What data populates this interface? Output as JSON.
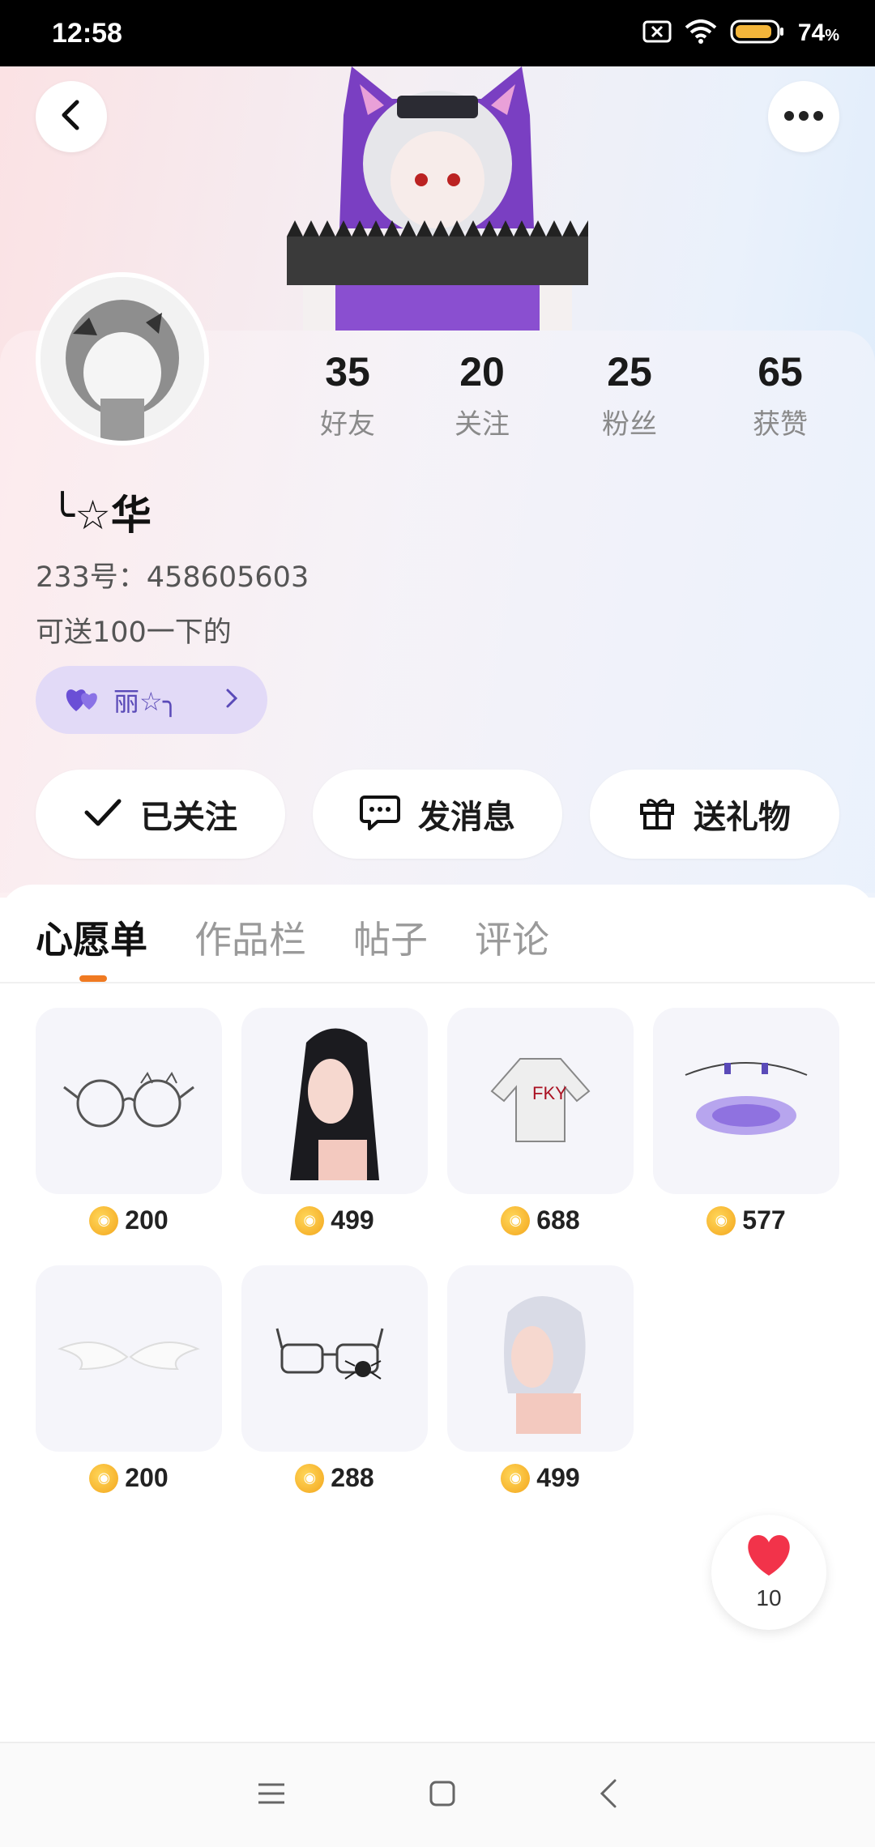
{
  "status_bar": {
    "time": "12:58",
    "battery": "74",
    "battery_unit": "%"
  },
  "profile": {
    "stats": [
      {
        "value": "35",
        "label": "好友"
      },
      {
        "value": "20",
        "label": "关注"
      },
      {
        "value": "25",
        "label": "粉丝"
      },
      {
        "value": "65",
        "label": "获赞"
      }
    ],
    "username": "╰☆华",
    "user_id": "233号：458605603",
    "bio": "可送100一下的",
    "cp_tag": "丽☆╮"
  },
  "actions": {
    "follow": "已关注",
    "message": "发消息",
    "gift": "送礼物"
  },
  "tabs": [
    "心愿单",
    "作品栏",
    "帖子",
    "评论"
  ],
  "wishlist": [
    {
      "icon": "glasses-cat-icon",
      "price": "200"
    },
    {
      "icon": "black-hair-icon",
      "price": "499"
    },
    {
      "icon": "jacket-icon",
      "price": "688"
    },
    {
      "icon": "halo-portal-icon",
      "price": "577"
    },
    {
      "icon": "wings-icon",
      "price": "200"
    },
    {
      "icon": "spider-glasses-icon",
      "price": "288"
    },
    {
      "icon": "white-hair-icon",
      "price": "499"
    }
  ],
  "like_fab": {
    "count": "10"
  },
  "colors": {
    "accent": "#f07a22",
    "cp_tag_bg": "#e2daf7",
    "cp_tag_text": "#5a4ab8",
    "like_heart": "#f2334a"
  }
}
